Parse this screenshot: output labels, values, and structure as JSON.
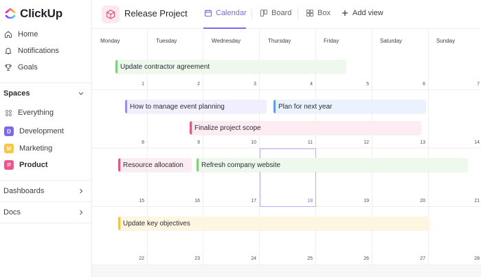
{
  "app": {
    "name": "ClickUp"
  },
  "sidebar": {
    "top_items": [
      {
        "label": "Home",
        "icon": "home-icon"
      },
      {
        "label": "Notifications",
        "icon": "bell-icon"
      },
      {
        "label": "Goals",
        "icon": "trophy-icon"
      }
    ],
    "spaces_title": "Spaces",
    "spaces": [
      {
        "label": "Everything",
        "icon": "grid-icon"
      },
      {
        "label": "Development",
        "badge": "D",
        "color": "#7b68ee"
      },
      {
        "label": "Marketing",
        "badge": "M",
        "color": "#ffc53d"
      },
      {
        "label": "Product",
        "badge": "P",
        "color": "#f0568c"
      }
    ],
    "dashboards_label": "Dashboards",
    "docs_label": "Docs"
  },
  "header": {
    "project_title": "Release Project",
    "views": [
      {
        "label": "Calendar",
        "icon": "calendar-icon",
        "active": true
      },
      {
        "label": "Board",
        "icon": "board-icon"
      },
      {
        "label": "Box",
        "icon": "box-icon"
      }
    ],
    "add_view_label": "Add view"
  },
  "calendar": {
    "weekdays": [
      "Monday",
      "Tuesday",
      "Wednesday",
      "Thursday",
      "Friday",
      "Saturday",
      "Sunday"
    ],
    "weeks": [
      [
        "1",
        "2",
        "3",
        "4",
        "5",
        "6",
        "7"
      ],
      [
        "8",
        "9",
        "10",
        "11",
        "12",
        "13",
        "14"
      ],
      [
        "15",
        "16",
        "17",
        "18",
        "19",
        "20",
        "21"
      ],
      [
        "22",
        "23",
        "24",
        "25",
        "26",
        "27",
        "28"
      ]
    ],
    "today": "18",
    "tasks": [
      {
        "label": "Update contractor agreement",
        "color": "#7ed17a",
        "bg": "#eef8ec"
      },
      {
        "label": "How to manage event planning",
        "color": "#9b8cf0",
        "bg": "#f1effd"
      },
      {
        "label": "Plan for next year",
        "color": "#5b9cf0",
        "bg": "#eaf2fd"
      },
      {
        "label": "Finalize project scope",
        "color": "#e3567f",
        "bg": "#fdecf1"
      },
      {
        "label": "Resource allocation",
        "color": "#e3567f",
        "bg": "#fdecf1"
      },
      {
        "label": "Refresh company website",
        "color": "#7ed17a",
        "bg": "#eef8ec"
      },
      {
        "label": "Update key objectives",
        "color": "#f5c542",
        "bg": "#fef6e1"
      }
    ]
  }
}
